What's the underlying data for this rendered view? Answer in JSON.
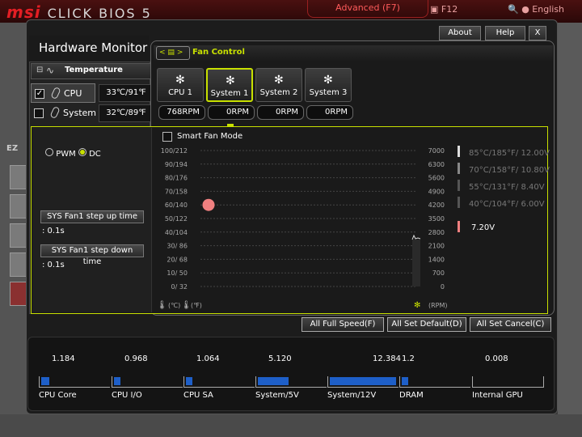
{
  "bios": {
    "brand": "msi",
    "product": "CLICK BIOS 5",
    "advanced_label": "Advanced (F7)",
    "f12_label": "F12",
    "language": "English",
    "ez_label": "EZ"
  },
  "window": {
    "title": "Hardware Monitor",
    "about_label": "About",
    "help_label": "Help",
    "close_label": "X"
  },
  "temperature": {
    "header": "Temperature",
    "rows": [
      {
        "name": "CPU",
        "value": "33℃/91℉",
        "checked": true
      },
      {
        "name": "System",
        "value": "32℃/89℉",
        "checked": false
      }
    ]
  },
  "fan_control": {
    "breadcrumb_back": "<",
    "breadcrumb_fwd": ">",
    "title": "Fan Control",
    "tabs": [
      {
        "label": "CPU 1",
        "rpm": "768RPM"
      },
      {
        "label": "System 1",
        "rpm": "0RPM"
      },
      {
        "label": "System 2",
        "rpm": "0RPM"
      },
      {
        "label": "System 3",
        "rpm": "0RPM"
      }
    ],
    "selected_tab": 1,
    "pwm_label": "PWM",
    "dc_label": "DC",
    "mode_selected": "DC",
    "smart_fan_mode": "Smart Fan Mode",
    "step_up_label": "SYS Fan1 step up time",
    "step_up_value": ": 0.1s",
    "step_down_label": "SYS Fan1 step down time",
    "step_down_value": ": 0.1s",
    "unit_c": "(℃)",
    "unit_f": "(℉)",
    "unit_rpm": "(RPM)"
  },
  "chart_data": {
    "type": "line",
    "temp_axis": [
      "100/212",
      "90/194",
      "80/176",
      "70/158",
      "60/140",
      "50/122",
      "40/104",
      "30/ 86",
      "20/ 68",
      "10/ 50",
      "0/ 32"
    ],
    "rpm_axis": [
      "7000",
      "6300",
      "5600",
      "4900",
      "4200",
      "3500",
      "2800",
      "2100",
      "1400",
      "700",
      "0"
    ],
    "current_point": {
      "temp_c": 60,
      "label": "current"
    },
    "voltage_levels": [
      {
        "label": "85°C/185°F/  12.00V",
        "active": false
      },
      {
        "label": "70°C/158°F/  10.80V",
        "active": false
      },
      {
        "label": "55°C/131°F/   8.40V",
        "active": false
      },
      {
        "label": "40°C/104°F/   6.00V",
        "active": false
      }
    ],
    "current_voltage": "7.20V"
  },
  "actions": {
    "full_speed": "All Full Speed(F)",
    "set_default": "All Set Default(D)",
    "set_cancel": "All Set Cancel(C)"
  },
  "voltages": [
    {
      "name": "CPU Core",
      "value": "1.184",
      "fill": 0.12
    },
    {
      "name": "CPU I/O",
      "value": "0.968",
      "fill": 0.1
    },
    {
      "name": "CPU SA",
      "value": "1.064",
      "fill": 0.1
    },
    {
      "name": "System/5V",
      "value": "5.120",
      "fill": 0.45
    },
    {
      "name": "System/12V",
      "value": "12.384",
      "fill": 0.98
    },
    {
      "name": "DRAM",
      "value": "1.2",
      "fill": 0.1
    },
    {
      "name": "Internal GPU",
      "value": "0.008",
      "fill": 0.0
    }
  ]
}
